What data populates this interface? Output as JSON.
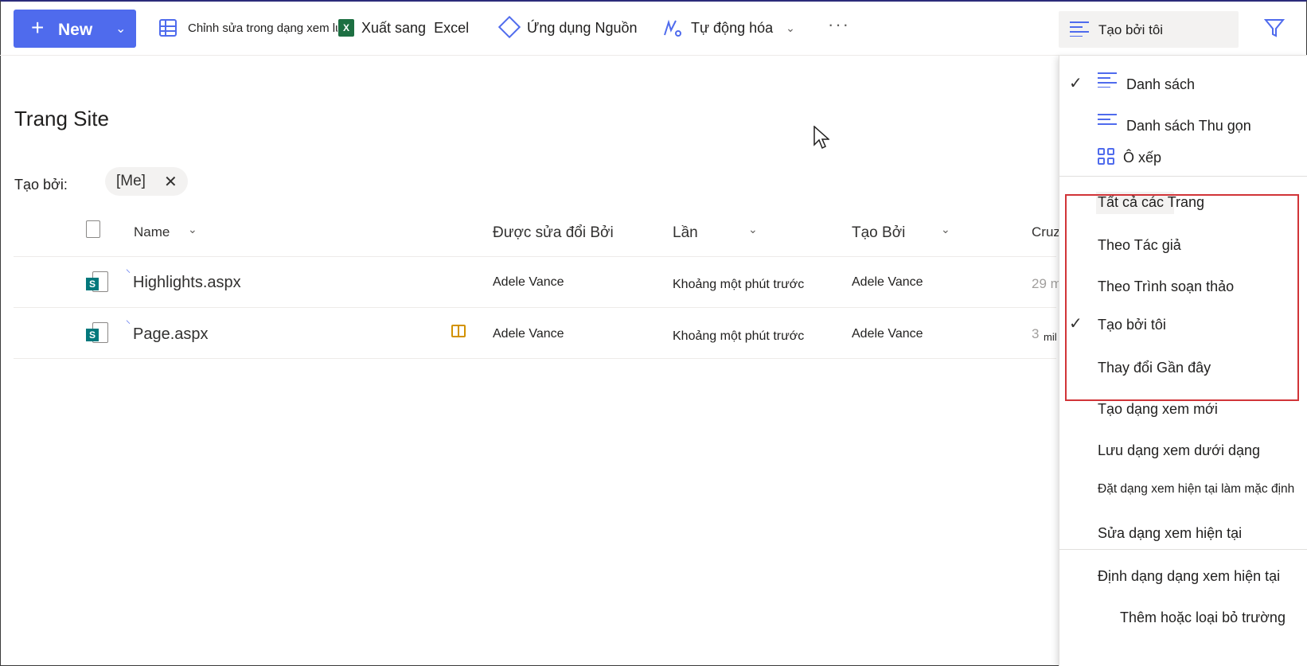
{
  "toolbar": {
    "new_label": "New",
    "edit_grid_label": "Chỉnh sửa trong dạng xem lưới",
    "export_label": "Xuất sang  Excel",
    "excel_badge": "X",
    "powerapps_label": "Ứng dụng Nguồn",
    "automate_label": "Tự động hóa",
    "more_label": "···",
    "current_view": "Tạo bởi tôi"
  },
  "page": {
    "title": "Trang Site",
    "filter_label": "Tạo bởi:",
    "filter_pill": "[Me]"
  },
  "table": {
    "headers": {
      "name": "Name",
      "modified_by": "Được sửa đổi Bởi",
      "time": "Lần",
      "created_by": "Tạo Bởi",
      "truncated": "Cruz"
    },
    "rows": [
      {
        "name": "Highlights.aspx",
        "modified_by": "Adele Vance",
        "time": "Khoảng một phút trước",
        "created_by": "Adele Vance",
        "extra": "29 m"
      },
      {
        "name": "Page.aspx",
        "modified_by": "Adele Vance",
        "time": "Khoảng một phút trước",
        "created_by": "Adele Vance",
        "extra": "3",
        "extra2": "mil"
      }
    ]
  },
  "menu": {
    "layouts": [
      {
        "label": "Danh sách",
        "checked": true
      },
      {
        "label": "Danh sách Thu gọn",
        "checked": false
      },
      {
        "label": "Ô xếp",
        "checked": false
      }
    ],
    "views": [
      {
        "label": "Tất cả các Trang",
        "checked": false
      },
      {
        "label": "Theo Tác giả",
        "checked": false
      },
      {
        "label": "Theo Trình soạn thảo",
        "checked": false
      },
      {
        "label": "Tạo bởi tôi",
        "checked": true
      },
      {
        "label": "Thay đổi Gần đây",
        "checked": false
      }
    ],
    "actions": [
      {
        "label": "Tạo dạng xem mới"
      },
      {
        "label": "Lưu dạng xem dưới dạng"
      },
      {
        "label": "Đặt dạng xem hiện tại làm mặc định"
      },
      {
        "label": "Sửa dạng xem hiện tại"
      }
    ],
    "format": [
      {
        "label": "Định dạng dạng xem hiện tại"
      },
      {
        "label": "Thêm hoặc loại bỏ trường"
      }
    ],
    "check_glyph": "✓"
  },
  "colors": {
    "accent": "#4f6bed",
    "highlight_border": "#d13438",
    "excel": "#1d6f42",
    "sharepoint": "#03787c"
  }
}
